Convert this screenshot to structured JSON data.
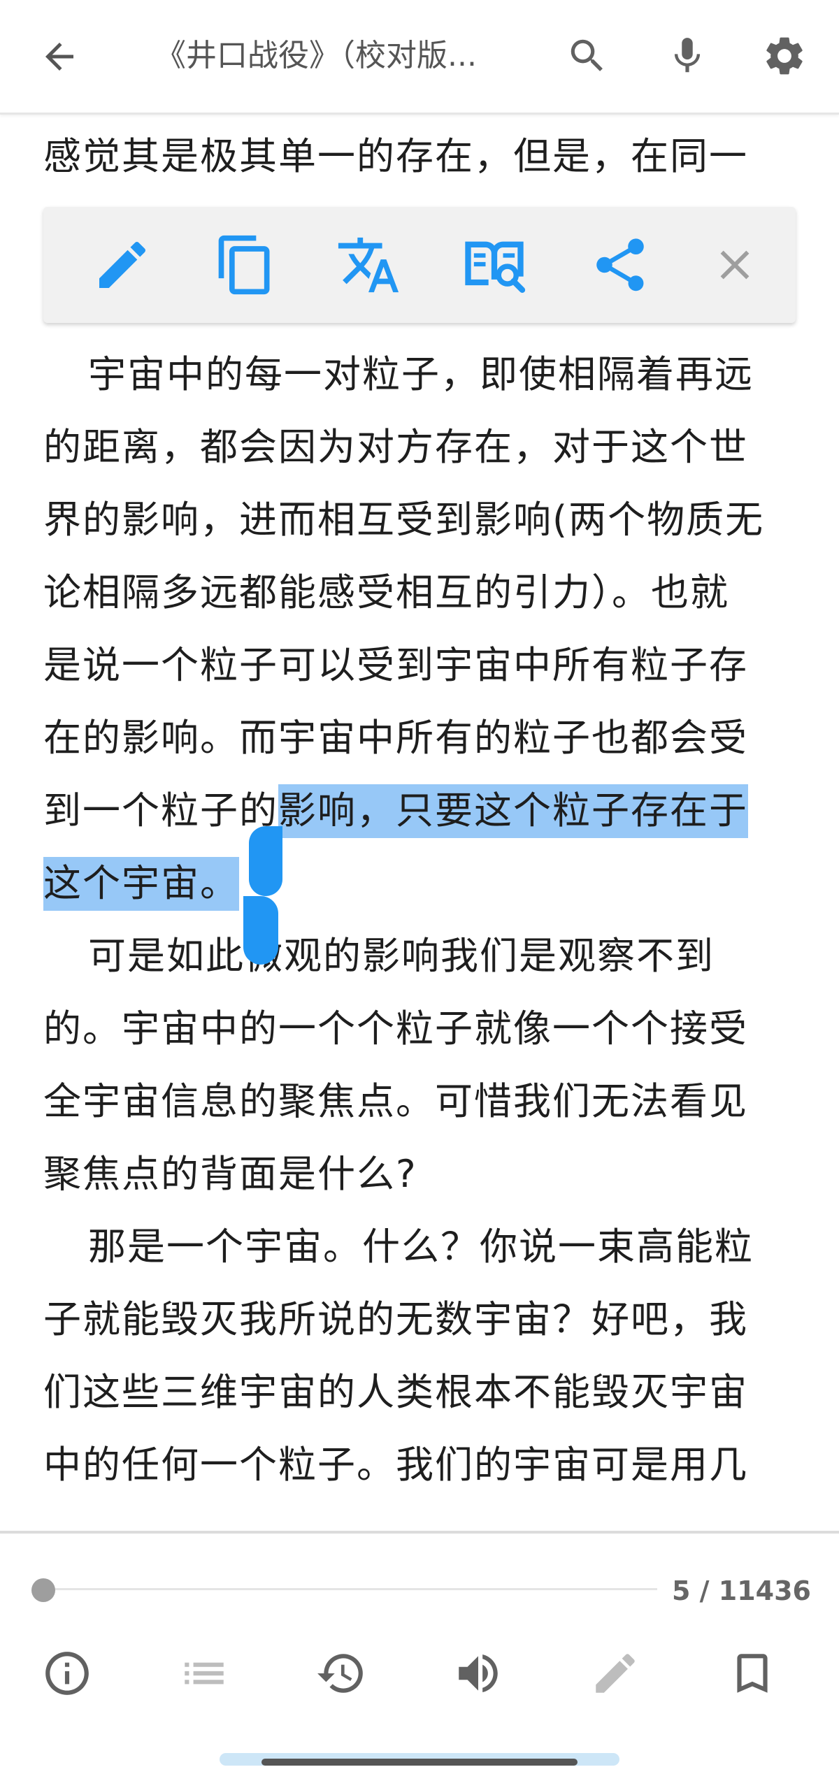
{
  "app_bar": {
    "title": "《井口战役》（校对版...",
    "icons": [
      "arrow-back-icon",
      "search-icon",
      "microphone-icon",
      "gear-icon"
    ]
  },
  "selection_toolbar": {
    "icons": [
      "pencil-icon",
      "copy-icon",
      "translate-icon",
      "dictionary-search-icon",
      "share-icon",
      "close-icon"
    ]
  },
  "reading": {
    "lines": [
      {
        "text": "感觉其是极其单一的存在，但是，在同一"
      },
      {
        "text": "宇宙中的每一对粒子，即使相隔着再远"
      },
      {
        "text": "的距离，都会因为对方存在，对于这个世"
      },
      {
        "text": "界的影响，进而相互受到影响(两个物质无"
      },
      {
        "text": "论相隔多远都能感受相互的引力）。也就"
      },
      {
        "text": "是说一个粒子可以受到宇宙中所有粒子存"
      },
      {
        "text": "在的影响。而宇宙中所有的粒子也都会受"
      },
      {
        "before": "到一个粒子的",
        "selected": "影响，只要这个粒子存在于"
      },
      {
        "selected": "这个宇宙。"
      },
      {
        "text": "可是如此微观的影响我们是观察不到"
      },
      {
        "text": "的。宇宙中的一个个粒子就像一个个接受"
      },
      {
        "text": "全宇宙信息的聚焦点。可惜我们无法看见"
      },
      {
        "text": "聚焦点的背面是什么?"
      },
      {
        "text": "那是一个宇宙。什么？你说一束高能粒"
      },
      {
        "text": "子就能毁灭我所说的无数宇宙？好吧，我"
      },
      {
        "text": "们这些三维宇宙的人类根本不能毁灭宇宙"
      },
      {
        "text": "中的任何一个粒子。我们的宇宙可是用几"
      }
    ]
  },
  "progress": {
    "current": 5,
    "total": 11436,
    "label": "5 / 11436",
    "fraction": 0.0004
  },
  "bottom_toolbar": {
    "icons": [
      "info-icon",
      "list-icon",
      "history-icon",
      "volume-icon",
      "edit-icon",
      "bookmark-icon"
    ]
  },
  "colors": {
    "accent": "#2196f3",
    "selection": "#97c8f7",
    "icon_gray": "#616161",
    "text": "#1e1e1e"
  }
}
